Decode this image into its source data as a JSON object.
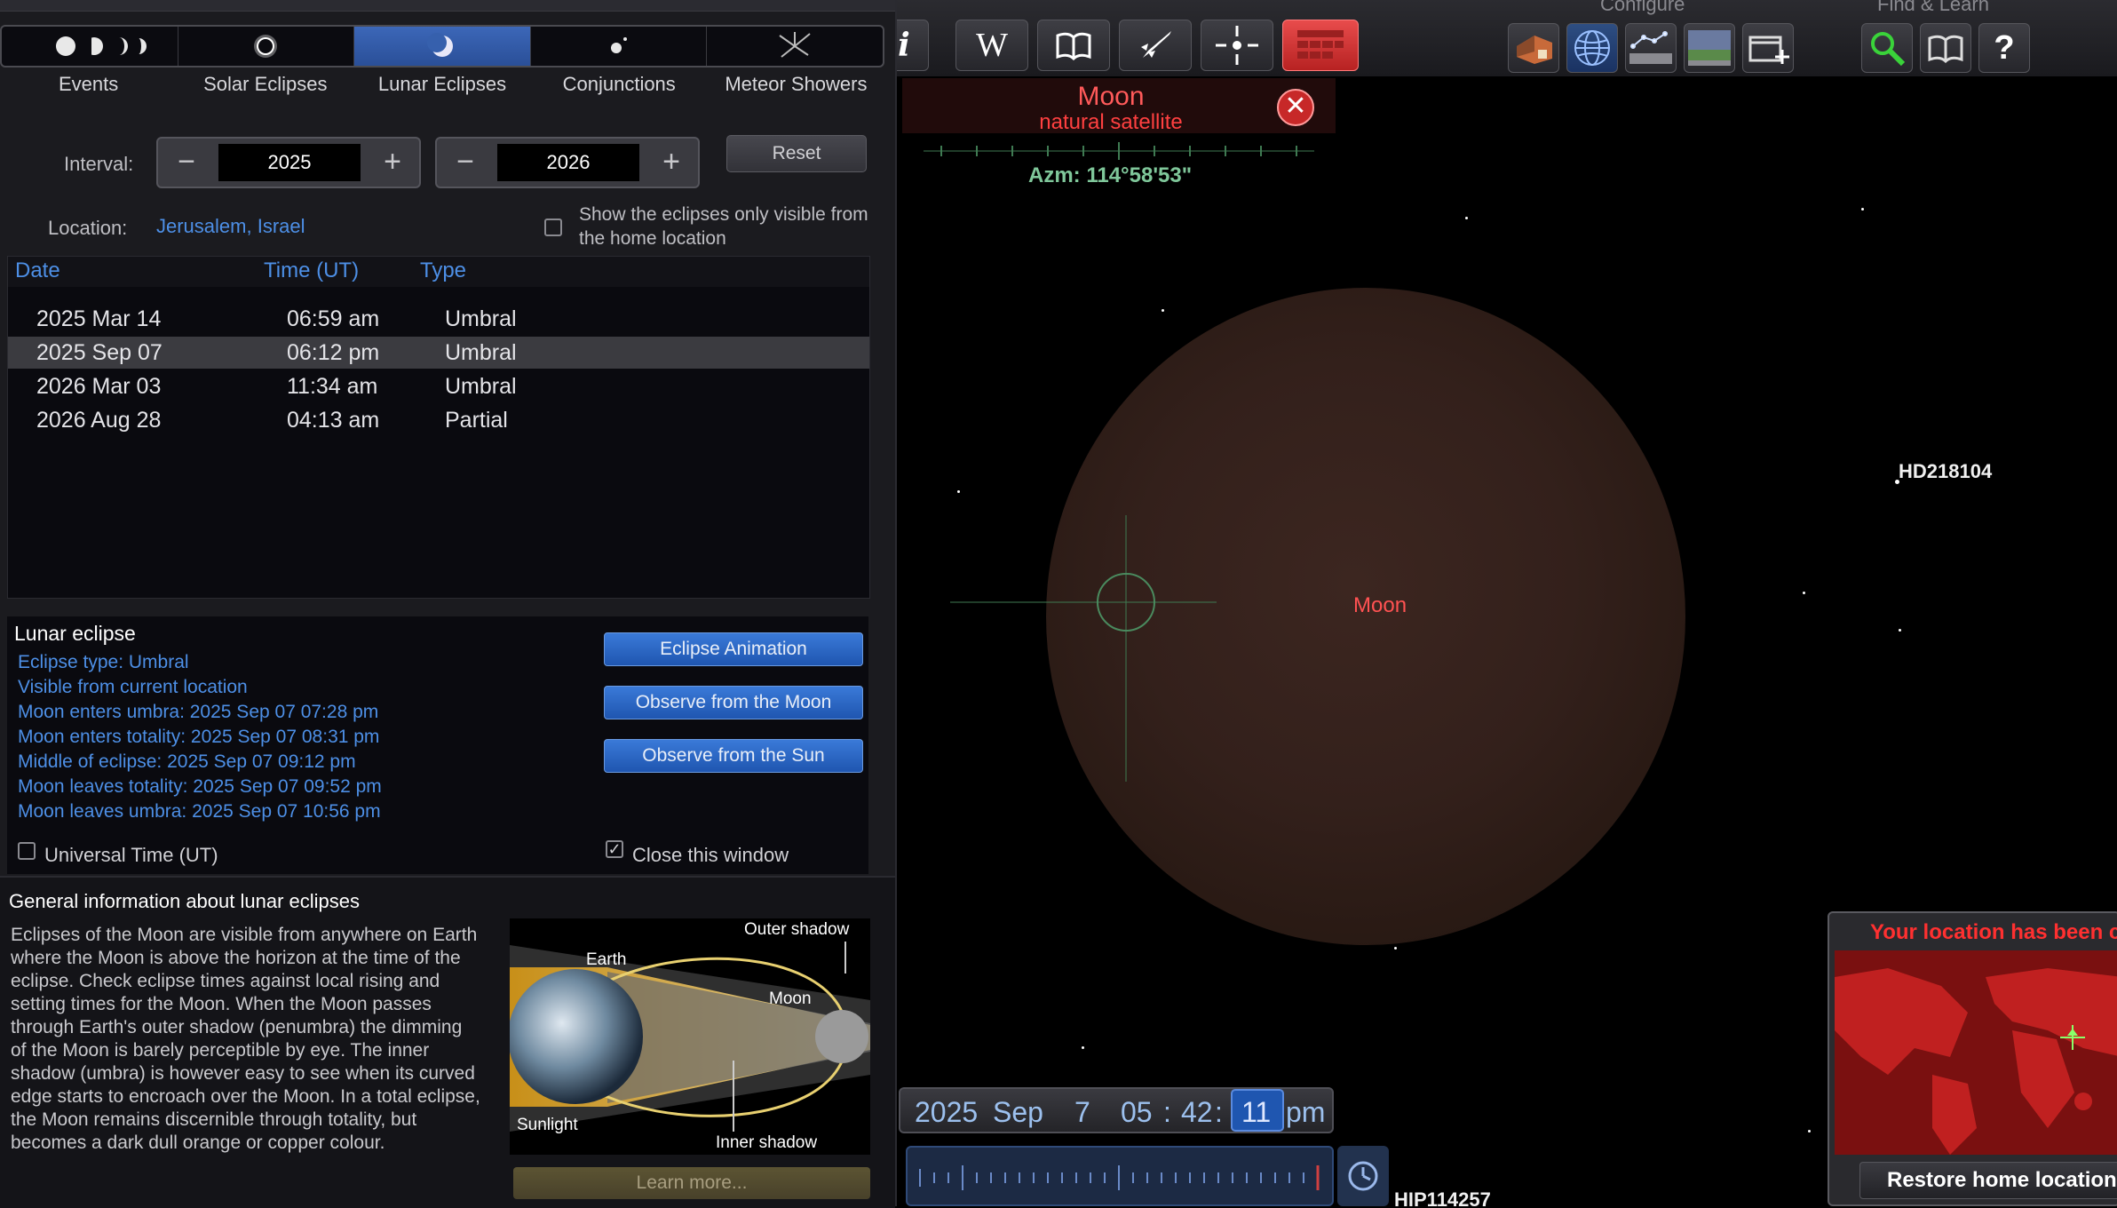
{
  "tabs": {
    "items": [
      "Events",
      "Solar Eclipses",
      "Lunar Eclipses",
      "Conjunctions",
      "Meteor Showers"
    ],
    "selected": "Lunar Eclipses"
  },
  "interval": {
    "label": "Interval:",
    "start": "2025",
    "end": "2026",
    "reset": "Reset"
  },
  "location": {
    "label": "Location:",
    "value": "Jerusalem, Israel",
    "checkbox_label": "Show the eclipses only visible from the home location"
  },
  "table": {
    "headers": [
      "Date",
      "Time (UT)",
      "Type"
    ],
    "rows": [
      {
        "date": "2025 Mar 14",
        "time": "06:59 am",
        "type": "Umbral"
      },
      {
        "date": "2025 Sep 07",
        "time": "06:12 pm",
        "type": "Umbral"
      },
      {
        "date": "2026 Mar 03",
        "time": "11:34 am",
        "type": "Umbral"
      },
      {
        "date": "2026 Aug 28",
        "time": "04:13 am",
        "type": "Partial"
      }
    ]
  },
  "info": {
    "title": "Lunar eclipse",
    "lines": [
      "Eclipse type: Umbral",
      "Visible from current location",
      "Moon enters umbra:  2025 Sep 07 07:28 pm",
      "Moon enters totality:  2025 Sep 07 08:31 pm",
      "Middle of eclipse:  2025 Sep 07 09:12 pm",
      "Moon leaves totality: 2025 Sep 07 09:52 pm",
      "Moon leaves umbra: 2025 Sep 07 10:56 pm"
    ],
    "buttons": [
      "Eclipse Animation",
      "Observe from the Moon",
      "Observe from the Sun"
    ],
    "ut_label": "Universal Time (UT)",
    "close_label": "Close this window"
  },
  "general": {
    "title": "General information about lunar eclipses",
    "body": "Eclipses of the Moon are visible from anywhere on Earth where the Moon is above the horizon at the time of the eclipse. Check eclipse times against local rising and setting times for the Moon. When the Moon passes through Earth's outer shadow (penumbra) the dimming of the Moon is barely perceptible by eye. The inner shadow (umbra) is however easy to see when its curved edge starts to encroach over the Moon. In a total eclipse, the Moon remains discernible through totality, but becomes a dark dull orange or copper colour.",
    "diagram_labels": {
      "outer": "Outer shadow",
      "earth": "Earth",
      "moon": "Moon",
      "sunlight": "Sunlight",
      "inner": "Inner shadow"
    },
    "learn_more": "Learn more..."
  },
  "toolbar": {
    "configure": "Configure",
    "find_learn": "Find & Learn"
  },
  "object": {
    "name": "Moon",
    "type": "natural satellite",
    "azimuth": "Azm: 114°58'53\""
  },
  "sky_labels": {
    "moon": "Moon",
    "star1": "HD218104",
    "star2": "HIP114257"
  },
  "time": {
    "year": "2025",
    "month": "Sep",
    "day": "7",
    "hour": "05",
    "sep1": ":",
    "minute": "42",
    "sep2": ":",
    "second": "11",
    "ampm": "pm"
  },
  "location_notice": {
    "title": "Your location has been changed",
    "restore": "Restore home location"
  }
}
